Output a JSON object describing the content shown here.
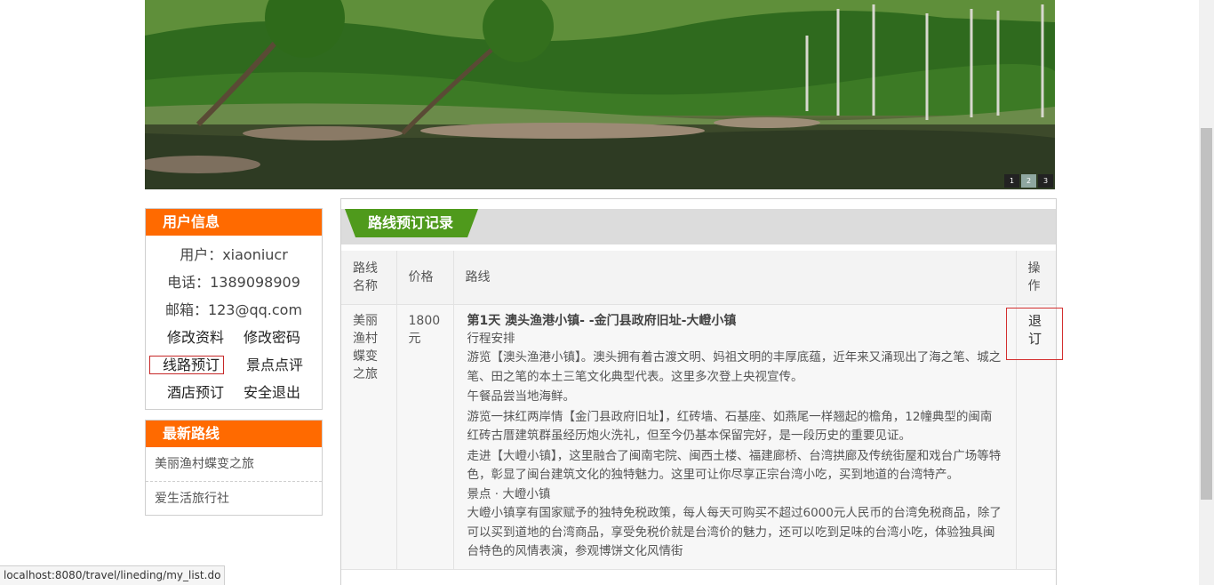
{
  "banner": {
    "slides": [
      "1",
      "2",
      "3"
    ],
    "active_slide": 2
  },
  "sidebar": {
    "user_info": {
      "heading": "用户信息",
      "user": "用户：xiaoniucr",
      "phone": "电话：1389098909",
      "email": "邮箱：123@qq.com",
      "links": [
        "修改资料",
        "修改密码",
        "线路预订",
        "景点点评",
        "酒店预订",
        "安全退出"
      ]
    },
    "latest": {
      "heading": "最新路线",
      "items": [
        "美丽渔村蝶变之旅",
        "爱生活旅行社"
      ]
    }
  },
  "main": {
    "title": "路线预订记录",
    "table": {
      "headers": [
        "路线名称",
        "价格",
        "路线",
        "操作"
      ],
      "rows": [
        {
          "name": "美丽渔村蝶变之旅",
          "price": "1800元",
          "route_title": "第1天 澳头渔港小镇- -金门县政府旧址-大嶝小镇",
          "route_lines": [
            "行程安排",
            "游览【澳头渔港小镇】。澳头拥有着古渡文明、妈祖文明的丰厚底蕴，近年来又涌现出了海之笔、城之笔、田之笔的本土三笔文化典型代表。这里多次登上央视宣传。",
            "午餐品尝当地海鲜。",
            "游览一抹红两岸情【金门县政府旧址】，红砖墙、石基座、如燕尾一样翘起的檐角，12幢典型的闽南红砖古厝建筑群虽经历炮火洗礼，但至今仍基本保留完好，是一段历史的重要见证。",
            "走进【大嶝小镇】，这里融合了闽南宅院、闽西土楼、福建廊桥、台湾拱廊及传统街屋和戏台广场等特色，彰显了闽台建筑文化的独特魅力。这里可让你尽享正宗台湾小吃，买到地道的台湾特产。",
            "景点 · 大嶝小镇",
            "大嶝小镇享有国家赋予的独特免税政策，每人每天可购买不超过6000元人民币的台湾免税商品，除了可以买到道地的台湾商品，享受免税价就是台湾价的魅力，还可以吃到足味的台湾小吃，体验独具闽台特色的风情表演，参观博饼文化风情街"
          ],
          "action": "退订"
        }
      ]
    }
  },
  "statusbar": {
    "url": "localhost:8080/travel/lineding/my_list.do"
  },
  "colors": {
    "orange_head": "#ff6a00",
    "green_tab": "#4f9a1c",
    "highlight_red": "#d32f2f"
  }
}
